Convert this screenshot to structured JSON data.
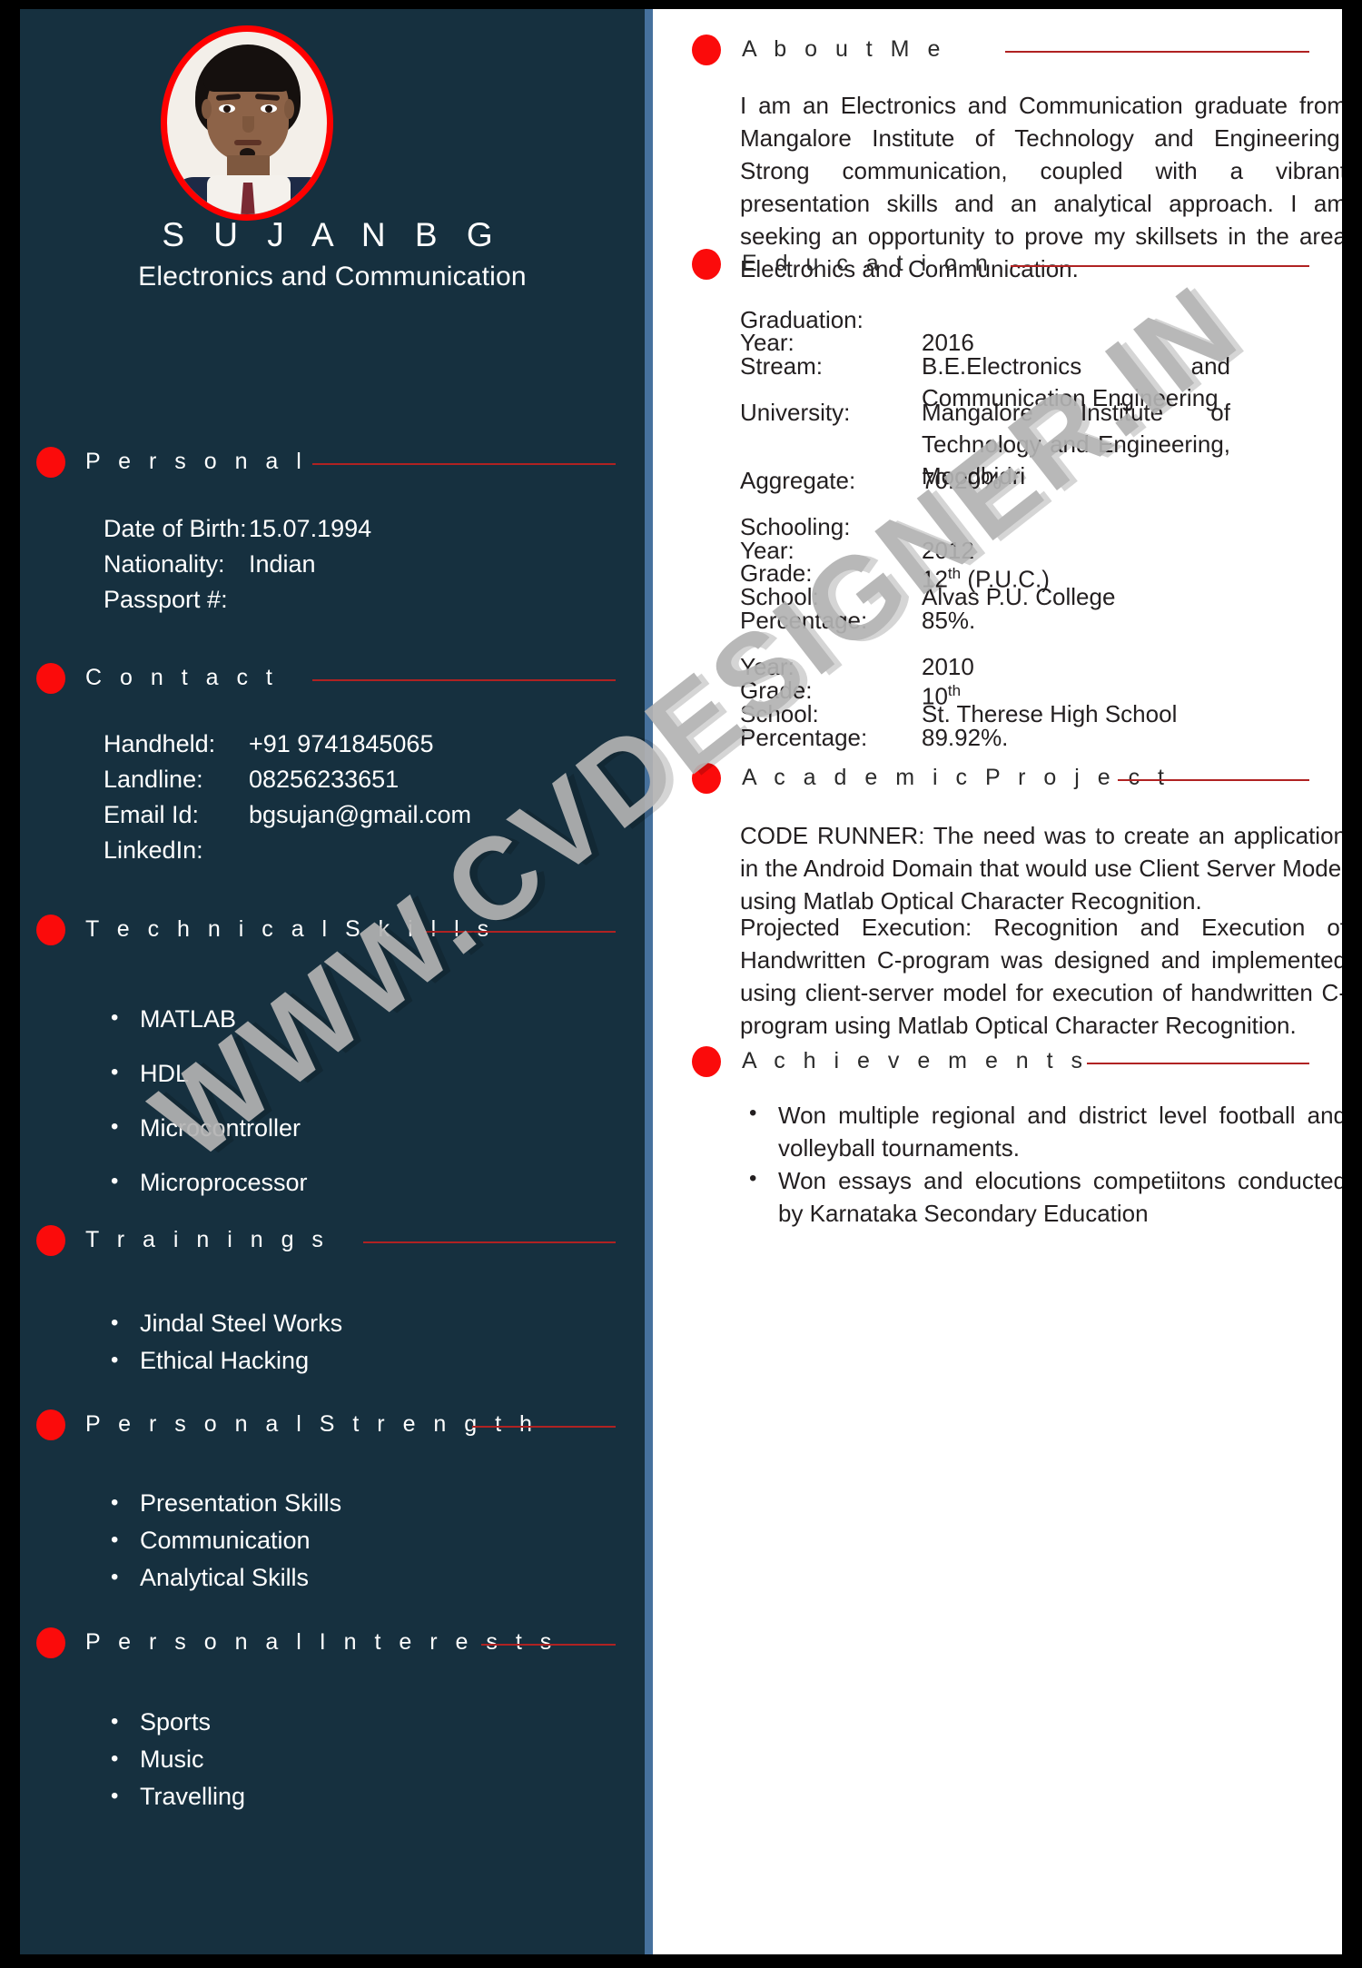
{
  "theme": {
    "panel_bg": "#16303f",
    "panel_stripe": "#46719d",
    "accent_red": "#fb0b0b",
    "rule_red": "#b02222",
    "page_bg": "#ffffff",
    "frame": "#000000"
  },
  "profile": {
    "name": "S U J A N   B G",
    "subtitle": "Electronics and Communication",
    "photo_alt": "profile-photo"
  },
  "watermark": {
    "text": "WWW.CVDESIGNER.IN"
  },
  "left": {
    "personal": {
      "title": "P e r s o n a l",
      "rows": [
        {
          "label": "Date of Birth:",
          "value": "15.07.1994"
        },
        {
          "label": "Nationality:",
          "value": "Indian"
        },
        {
          "label": "Passport #:",
          "value": ""
        }
      ]
    },
    "contact": {
      "title": "C o n t a c t",
      "rows": [
        {
          "label": "Handheld:",
          "value": "+91 9741845065"
        },
        {
          "label": "Landline:",
          "value": "08256233651"
        },
        {
          "label": "Email Id:",
          "value": "bgsujan@gmail.com"
        },
        {
          "label": "LinkedIn:",
          "value": ""
        }
      ]
    },
    "technical_skills": {
      "title": "T e c h n i c a l   S k i l l s",
      "items": [
        "MATLAB",
        "HDL",
        "Microcontroller",
        "Microprocessor"
      ]
    },
    "trainings": {
      "title": "T r a i n i n g s",
      "items": [
        "Jindal Steel Works",
        "Ethical Hacking"
      ]
    },
    "personal_strength": {
      "title": "P e r s o n a l   S t r e n g t h",
      "items": [
        "Presentation Skills",
        "Communication",
        "Analytical Skills"
      ]
    },
    "personal_interests": {
      "title": "P e r s o n a l   I n t e r e s t s",
      "items": [
        "Sports",
        "Music",
        "Travelling"
      ]
    }
  },
  "right": {
    "about": {
      "title": "A b o u t   M e",
      "text": "I am an Electronics and Communication graduate from Mangalore Institute of Technology and Engineering. Strong communication, coupled with a vibrant presentation skills and an analytical approach. I am seeking an opportunity to prove my skillsets in the area Electronics and Communication."
    },
    "education": {
      "title": "E d u c a t i o n",
      "graduation_heading": "Graduation:",
      "graduation": [
        {
          "label": "Year:",
          "value": "2016"
        },
        {
          "label": "Stream:",
          "value": "B.E.Electronics and Communication Engineering"
        },
        {
          "label": "University:",
          "value": "Mangalore Institute of Technology and Engineering, Moodbidri"
        },
        {
          "label": "Aggregate:",
          "value": "70.20%"
        }
      ],
      "schooling_heading": "Schooling:",
      "schooling_1": [
        {
          "label": "Year:",
          "value": "2012"
        },
        {
          "label": "Grade:",
          "value": "12th (P.U.C.)",
          "value_base": "12",
          "value_sup": "th",
          "value_tail": " (P.U.C.)"
        },
        {
          "label": "School:",
          "value": "Alvas P.U. College"
        },
        {
          "label": "Percentage:",
          "value": "85%."
        }
      ],
      "schooling_2": [
        {
          "label": "Year:",
          "value": "2010"
        },
        {
          "label": "Grade:",
          "value": "10th",
          "value_base": "10",
          "value_sup": "th",
          "value_tail": ""
        },
        {
          "label": "School:",
          "value": "St. Therese High School"
        },
        {
          "label": "Percentage:",
          "value": "89.92%."
        }
      ]
    },
    "academic_project": {
      "title": "A c a d e m i c   P r o j e c t",
      "paragraph_1": "CODE RUNNER: The need was to create an application in the Android Domain that would use Client Server Model using Matlab Optical Character Recognition.",
      "paragraph_2": "Projected Execution:  Recognition and Execution of Handwritten C-program was designed and implemented using client-server model for execution of handwritten C-program using Matlab Optical Character Recognition."
    },
    "achievements": {
      "title": "A c h i e v e m e n t s",
      "items": [
        "Won multiple regional and district level football and volleyball tournaments.",
        "Won essays and elocutions competiitons conducted by Karnataka Secondary Education"
      ]
    }
  }
}
